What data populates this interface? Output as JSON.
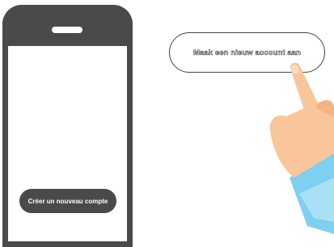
{
  "phone": {
    "button_label": "Créer un nouveau compte"
  },
  "bubble": {
    "label": "Maak een nieuw account aan"
  },
  "colors": {
    "phone_frame": "#4a4a4a",
    "skin": "#f9c59a",
    "sleeve": "#7ecff0"
  },
  "icons": {
    "hand": "pointing-hand-icon",
    "speaker": "phone-speaker-icon"
  }
}
